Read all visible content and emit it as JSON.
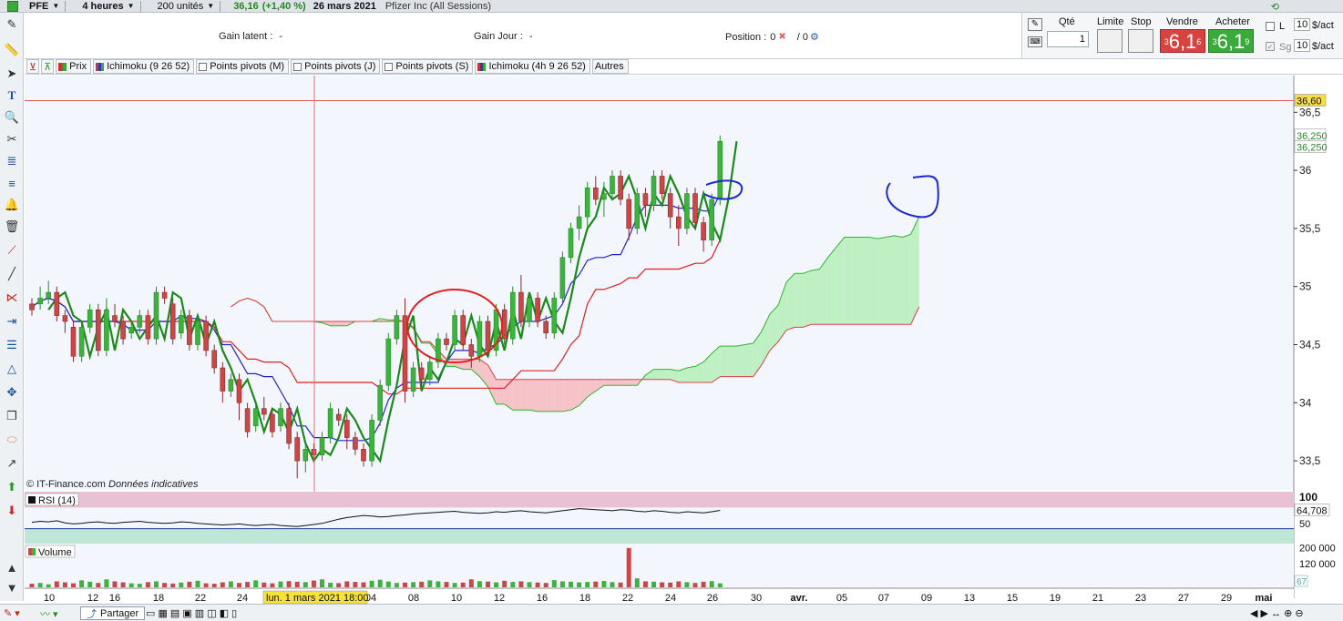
{
  "topbar": {
    "symbol": "PFE",
    "interval": "4 heures",
    "units": "200 unités",
    "last": "36,16",
    "change": "(+1,40 %)",
    "date": "26 mars 2021",
    "instrument": "Pfizer Inc (All Sessions)"
  },
  "trade_header": {
    "gain_latent_label": "Gain latent :",
    "gain_latent_value": "-",
    "gain_jour_label": "Gain Jour :",
    "gain_jour_value": "-",
    "position_label": "Position :",
    "position_value": "0",
    "position_sep": "/",
    "position_value2": "0"
  },
  "order_panel": {
    "qty_label": "Qté",
    "qty_value": "1",
    "limit_label": "Limite",
    "stop_label": "Stop",
    "sell_label": "Vendre",
    "buy_label": "Acheter",
    "sell_price_prefix": "3",
    "sell_price_main": "6,1",
    "sell_price_sup": "6",
    "buy_price_prefix": "3",
    "buy_price_main": "6,1",
    "buy_price_sup": "9",
    "l_label": "L",
    "sg_label": "Sg",
    "lot1": "10",
    "lot1_unit": "$/act",
    "lot2": "10",
    "lot2_unit": "$/act"
  },
  "indicators": [
    "Prix",
    "Ichimoku (9 26 52)",
    "Points pivots (M)",
    "Points pivots (J)",
    "Points pivots (S)",
    "Ichimoku (4h 9 26 52)",
    "Autres"
  ],
  "price_panel": {
    "watermark": "© IT-Finance.com",
    "watermark_italic": "Données indicatives",
    "hline_label": "36,60",
    "last_label_1": "36,250",
    "last_label_2": "36,250"
  },
  "rsi_panel": {
    "title": "RSI (14)",
    "value_label": "64,708",
    "level_100": "100",
    "level_50": "50"
  },
  "volume_panel": {
    "title": "Volume",
    "tick_200k": "200 000",
    "tick_120k": "120 000",
    "last_label": "67"
  },
  "crosshair_label": "lun. 1 mars 2021 18:00",
  "bottom_bar": {
    "share_label": "Partager"
  },
  "colors": {
    "bull": "#3cb33c",
    "bear": "#c84848",
    "cloud_bull": "#bff0c4",
    "cloud_bear": "#f6c3c8",
    "tenkan": "#2222cc",
    "kijun": "#e02020",
    "chikou": "#1a8a1a"
  },
  "chart_data": {
    "type": "candlestick",
    "timeframe": "4 heures",
    "y_axis_ticks": [
      33.5,
      34,
      34.5,
      35,
      35.5,
      36,
      36.5
    ],
    "x_axis_labels": [
      "10",
      "12",
      "16",
      "18",
      "22",
      "24",
      "04",
      "08",
      "10",
      "12",
      "16",
      "18",
      "22",
      "24",
      "26",
      "30",
      "avr.",
      "05",
      "07",
      "09",
      "13",
      "15",
      "19",
      "21",
      "23",
      "27",
      "29",
      "mai"
    ],
    "ylim": [
      33.25,
      36.8
    ],
    "hline": 36.6,
    "candles": [
      [
        34.85,
        34.8,
        34.9,
        34.75
      ],
      [
        34.85,
        34.9,
        35.0,
        34.8
      ],
      [
        34.9,
        34.95,
        35.05,
        34.85
      ],
      [
        34.95,
        34.75,
        35.0,
        34.7
      ],
      [
        34.75,
        34.7,
        34.8,
        34.6
      ],
      [
        34.65,
        34.4,
        34.7,
        34.35
      ],
      [
        34.4,
        34.65,
        34.7,
        34.35
      ],
      [
        34.65,
        34.8,
        34.85,
        34.6
      ],
      [
        34.8,
        34.45,
        34.85,
        34.4
      ],
      [
        34.45,
        34.8,
        34.9,
        34.4
      ],
      [
        34.75,
        34.7,
        34.85,
        34.65
      ],
      [
        34.7,
        34.55,
        34.75,
        34.5
      ],
      [
        34.6,
        34.65,
        34.7,
        34.55
      ],
      [
        34.65,
        34.75,
        34.8,
        34.6
      ],
      [
        34.75,
        34.55,
        34.8,
        34.5
      ],
      [
        34.55,
        34.95,
        35.0,
        34.5
      ],
      [
        34.95,
        34.9,
        35.0,
        34.85
      ],
      [
        34.85,
        34.55,
        34.9,
        34.5
      ],
      [
        34.6,
        34.75,
        34.8,
        34.55
      ],
      [
        34.75,
        34.5,
        34.8,
        34.45
      ],
      [
        34.5,
        34.7,
        34.75,
        34.45
      ],
      [
        34.7,
        34.45,
        34.75,
        34.4
      ],
      [
        34.45,
        34.3,
        34.5,
        34.25
      ],
      [
        34.3,
        34.1,
        34.35,
        34.0
      ],
      [
        34.1,
        34.2,
        34.25,
        34.05
      ],
      [
        34.2,
        34.0,
        34.25,
        33.85
      ],
      [
        33.95,
        33.75,
        34.0,
        33.7
      ],
      [
        33.8,
        33.95,
        34.0,
        33.75
      ],
      [
        33.95,
        33.9,
        34.05,
        33.85
      ],
      [
        33.9,
        33.75,
        33.95,
        33.7
      ],
      [
        33.8,
        33.95,
        34.0,
        33.75
      ],
      [
        33.95,
        33.65,
        34.0,
        33.6
      ],
      [
        33.7,
        33.5,
        33.75,
        33.35
      ],
      [
        33.5,
        33.6,
        33.65,
        33.4
      ],
      [
        33.6,
        33.55,
        33.65,
        33.5
      ],
      [
        33.55,
        33.7,
        33.75,
        33.5
      ],
      [
        33.7,
        33.95,
        34.0,
        33.65
      ],
      [
        33.9,
        33.85,
        33.95,
        33.8
      ],
      [
        33.85,
        33.7,
        33.9,
        33.6
      ],
      [
        33.7,
        33.6,
        33.75,
        33.55
      ],
      [
        33.6,
        33.5,
        33.65,
        33.45
      ],
      [
        33.5,
        33.85,
        33.9,
        33.45
      ],
      [
        33.85,
        34.15,
        34.2,
        33.8
      ],
      [
        34.15,
        34.55,
        34.6,
        34.1
      ],
      [
        34.55,
        34.75,
        34.8,
        34.5
      ],
      [
        34.75,
        34.1,
        34.9,
        34.0
      ],
      [
        34.1,
        34.3,
        34.35,
        34.05
      ],
      [
        34.3,
        34.2,
        34.35,
        34.15
      ],
      [
        34.2,
        34.35,
        34.4,
        34.15
      ],
      [
        34.35,
        34.55,
        34.6,
        34.3
      ],
      [
        34.55,
        34.5,
        34.6,
        34.45
      ],
      [
        34.5,
        34.75,
        34.8,
        34.45
      ],
      [
        34.75,
        34.5,
        34.8,
        34.45
      ],
      [
        34.5,
        34.4,
        34.55,
        34.3
      ],
      [
        34.4,
        34.7,
        34.75,
        34.35
      ],
      [
        34.7,
        34.45,
        34.75,
        34.4
      ],
      [
        34.45,
        34.8,
        34.85,
        34.4
      ],
      [
        34.8,
        34.55,
        34.85,
        34.5
      ],
      [
        34.55,
        34.95,
        35.0,
        34.5
      ],
      [
        34.95,
        34.7,
        35.1,
        34.65
      ],
      [
        34.7,
        34.9,
        34.95,
        34.65
      ],
      [
        34.9,
        34.7,
        34.95,
        34.65
      ],
      [
        34.7,
        34.6,
        34.75,
        34.55
      ],
      [
        34.6,
        34.9,
        34.95,
        34.55
      ],
      [
        34.9,
        35.25,
        35.3,
        34.85
      ],
      [
        35.25,
        35.5,
        35.55,
        35.2
      ],
      [
        35.5,
        35.6,
        35.7,
        35.4
      ],
      [
        35.6,
        35.85,
        35.9,
        35.5
      ],
      [
        35.85,
        35.75,
        35.95,
        35.7
      ],
      [
        35.75,
        35.8,
        35.9,
        35.6
      ],
      [
        35.8,
        35.95,
        36.0,
        35.75
      ],
      [
        35.95,
        35.75,
        36.0,
        35.7
      ],
      [
        35.75,
        35.5,
        35.8,
        35.4
      ],
      [
        35.5,
        35.8,
        35.85,
        35.45
      ],
      [
        35.8,
        35.7,
        35.85,
        35.6
      ],
      [
        35.7,
        35.95,
        36.0,
        35.65
      ],
      [
        35.95,
        35.8,
        36.0,
        35.75
      ],
      [
        35.8,
        35.6,
        35.85,
        35.5
      ],
      [
        35.6,
        35.5,
        35.7,
        35.35
      ],
      [
        35.5,
        35.8,
        35.85,
        35.45
      ],
      [
        35.8,
        35.55,
        35.85,
        35.5
      ],
      [
        35.55,
        35.4,
        35.6,
        35.3
      ],
      [
        35.4,
        35.75,
        35.8,
        35.35
      ],
      [
        35.75,
        36.25,
        36.3,
        35.7
      ]
    ],
    "rsi": [
      42,
      44,
      43,
      45,
      41,
      39,
      40,
      42,
      43,
      41,
      40,
      42,
      43,
      44,
      42,
      41,
      40,
      41,
      43,
      42,
      40,
      39,
      38,
      37,
      38,
      39,
      37,
      36,
      37,
      38,
      36,
      35,
      34,
      36,
      38,
      40,
      44,
      48,
      51,
      53,
      55,
      54,
      52,
      53,
      55,
      56,
      58,
      59,
      60,
      61,
      62,
      63,
      61,
      60,
      59,
      60,
      62,
      61,
      63,
      64,
      62,
      61,
      60,
      62,
      64,
      66,
      68,
      67,
      66,
      65,
      64,
      66,
      65,
      63,
      62,
      64,
      63,
      61,
      60,
      62,
      61,
      60,
      62,
      64.7
    ],
    "volume": [
      18,
      22,
      15,
      30,
      25,
      20,
      35,
      28,
      22,
      40,
      30,
      25,
      20,
      18,
      26,
      30,
      22,
      19,
      24,
      28,
      33,
      20,
      18,
      25,
      30,
      22,
      27,
      35,
      24,
      20,
      29,
      31,
      28,
      26,
      34,
      40,
      23,
      21,
      30,
      27,
      25,
      33,
      38,
      29,
      22,
      24,
      26,
      28,
      35,
      30,
      27,
      22,
      24,
      40,
      31,
      29,
      25,
      33,
      27,
      30,
      26,
      24,
      22,
      36,
      30,
      28,
      25,
      27,
      29,
      32,
      26,
      24,
      198,
      45,
      30,
      28,
      25,
      24,
      30,
      26,
      22,
      28,
      31,
      20
    ]
  }
}
